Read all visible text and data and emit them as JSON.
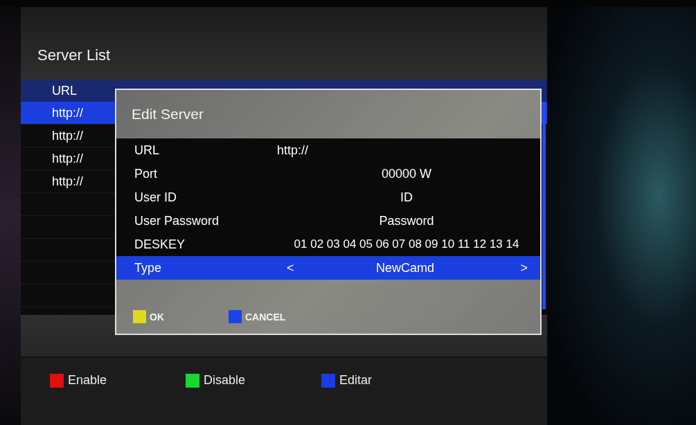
{
  "screen": {
    "title": "Server List"
  },
  "server_list": {
    "header": "URL",
    "rows": [
      {
        "url": "http://",
        "selected": true
      },
      {
        "url": "http://",
        "selected": false
      },
      {
        "url": "http://",
        "selected": false
      },
      {
        "url": "http://",
        "selected": false
      }
    ]
  },
  "dialog": {
    "title": "Edit Server",
    "fields": [
      {
        "kind": "url",
        "label": "URL",
        "value": "http://",
        "selected": false
      },
      {
        "kind": "text",
        "label": "Port",
        "value": "00000 W",
        "selected": false
      },
      {
        "kind": "text",
        "label": "User ID",
        "value": "ID",
        "selected": false
      },
      {
        "kind": "text",
        "label": "User Password",
        "value": "Password",
        "selected": false
      },
      {
        "kind": "text",
        "label": "DESKEY",
        "value": "01 02 03 04 05 06 07 08 09 10 11 12 13 14",
        "selected": false
      },
      {
        "kind": "choice",
        "label": "Type",
        "value": "NewCamd",
        "prev": "<",
        "next": ">",
        "selected": true
      }
    ],
    "buttons": [
      {
        "label": "OK",
        "color": "#e0d81a"
      },
      {
        "label": "CANCEL",
        "color": "#1a44e8"
      }
    ]
  },
  "legend": [
    {
      "label": "Enable",
      "color": "#e01010"
    },
    {
      "label": "Disable",
      "color": "#18d830"
    },
    {
      "label": "Editar",
      "color": "#1a3ce0"
    }
  ]
}
